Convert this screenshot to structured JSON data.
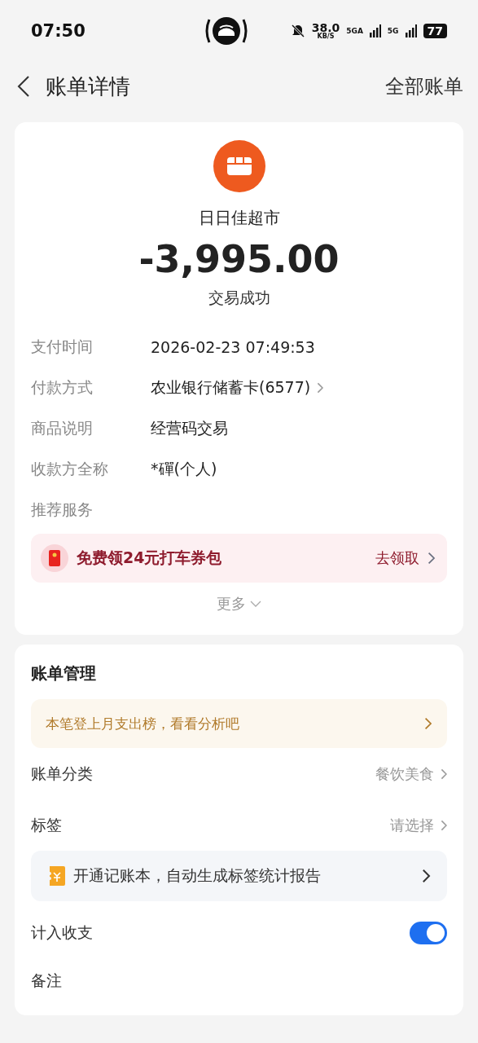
{
  "status_bar": {
    "time": "07:50",
    "net_speed": "38.0",
    "net_unit": "KB/S",
    "sim1": "5GA",
    "sim2": "5G",
    "battery": "77"
  },
  "header": {
    "title": "账单详情",
    "action": "全部账单"
  },
  "summary": {
    "merchant": "日日佳超市",
    "amount": "-3,995.00",
    "status": "交易成功"
  },
  "details": [
    {
      "kind": "text",
      "label": "支付时间",
      "value": "2026-02-23 07:49:53"
    },
    {
      "kind": "link",
      "label": "付款方式",
      "value": "农业银行储蓄卡(6577)"
    },
    {
      "kind": "text",
      "label": "商品说明",
      "value": "经营码交易"
    },
    {
      "kind": "text",
      "label": "收款方全称",
      "value": "*磾(个人)"
    },
    {
      "kind": "heading",
      "label": "推荐服务"
    }
  ],
  "promo": {
    "text": "免费领24元打车券包",
    "action": "去领取"
  },
  "more": "更多",
  "management": {
    "title": "账单管理",
    "banner": "本笔登上月支出榜，看看分析吧",
    "rows": [
      {
        "kind": "select",
        "label": "账单分类",
        "value": "餐饮美食"
      },
      {
        "kind": "select",
        "label": "标签",
        "value": "请选择"
      },
      {
        "kind": "notice",
        "text": "开通记账本，自动生成标签统计报告"
      },
      {
        "kind": "toggle",
        "label": "计入收支",
        "on": true
      },
      {
        "kind": "plain",
        "label": "备注"
      }
    ]
  }
}
